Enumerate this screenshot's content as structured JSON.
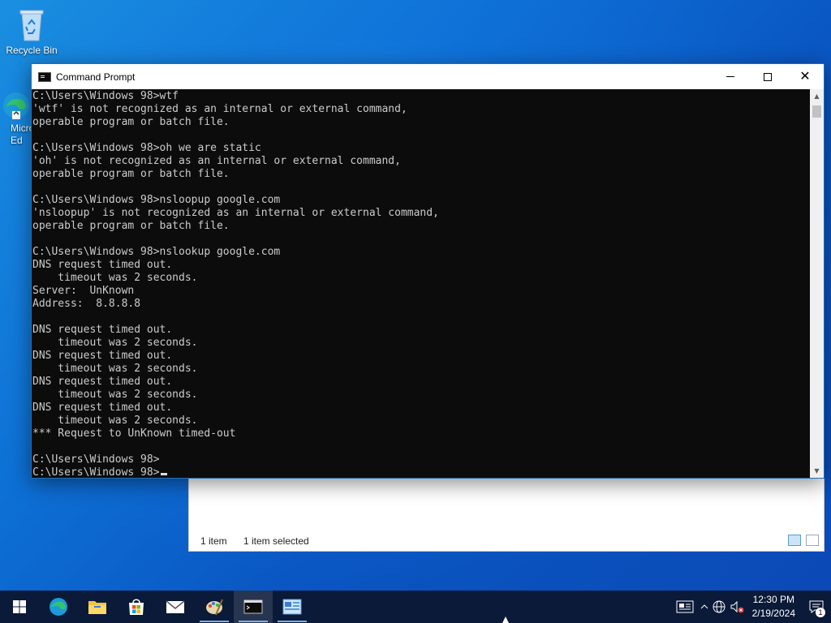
{
  "desktop": {
    "recycle_bin_label": "Recycle Bin",
    "edge_label_partial": "Micro Ed"
  },
  "explorer": {
    "status_items": "1 item",
    "status_selected": "1 item selected"
  },
  "cmd": {
    "title": "Command Prompt",
    "lines": [
      "C:\\Users\\Windows 98>wtf",
      "'wtf' is not recognized as an internal or external command,",
      "operable program or batch file.",
      "",
      "C:\\Users\\Windows 98>oh we are static",
      "'oh' is not recognized as an internal or external command,",
      "operable program or batch file.",
      "",
      "C:\\Users\\Windows 98>nsloopup google.com",
      "'nsloopup' is not recognized as an internal or external command,",
      "operable program or batch file.",
      "",
      "C:\\Users\\Windows 98>nslookup google.com",
      "DNS request timed out.",
      "    timeout was 2 seconds.",
      "Server:  UnKnown",
      "Address:  8.8.8.8",
      "",
      "DNS request timed out.",
      "    timeout was 2 seconds.",
      "DNS request timed out.",
      "    timeout was 2 seconds.",
      "DNS request timed out.",
      "    timeout was 2 seconds.",
      "DNS request timed out.",
      "    timeout was 2 seconds.",
      "*** Request to UnKnown timed-out",
      "",
      "C:\\Users\\Windows 98>"
    ],
    "prompt": "C:\\Users\\Windows 98>"
  },
  "taskbar": {
    "apps": [
      "start-icon",
      "edge-icon",
      "file-explorer-icon",
      "store-icon",
      "mail-icon",
      "paint-icon",
      "cmd-icon",
      "control-panel-icon"
    ]
  },
  "tray": {
    "time": "12:30 PM",
    "date": "2/19/2024",
    "notification_count": "1"
  },
  "colors": {
    "console_bg": "#0c0c0c",
    "console_text": "#cccccc",
    "taskbar_bg": "#0a1a38"
  }
}
